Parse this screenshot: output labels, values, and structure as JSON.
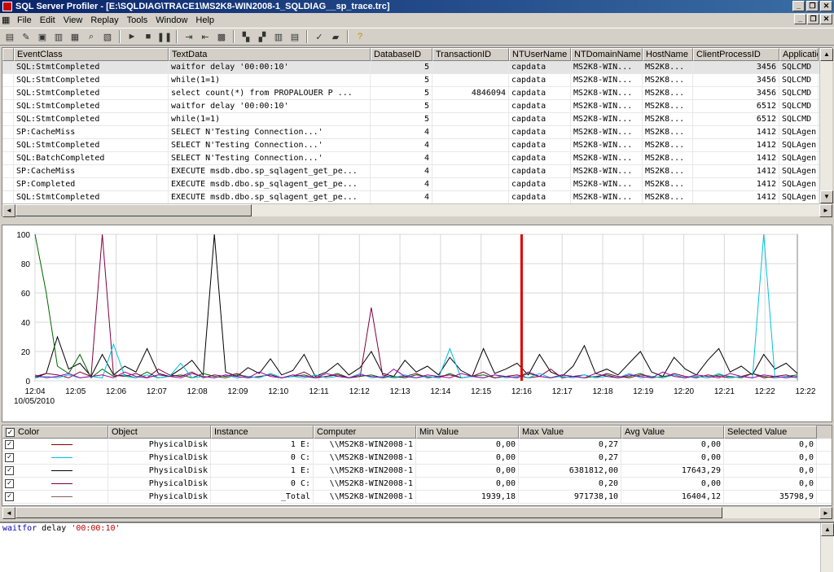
{
  "window": {
    "title": "SQL Server Profiler - [E:\\SQLDIAG\\TRACE1\\MS2K8-WIN2008-1_SQLDIAG__sp_trace.trc]"
  },
  "menu": [
    "File",
    "Edit",
    "View",
    "Replay",
    "Tools",
    "Window",
    "Help"
  ],
  "trace": {
    "columns": [
      "EventClass",
      "TextData",
      "DatabaseID",
      "TransactionID",
      "NTUserName",
      "NTDomainName",
      "HostName",
      "ClientProcessID",
      "Applicatio"
    ],
    "rows": [
      [
        "SQL:StmtCompleted",
        "waitfor delay '00:00:10'",
        "5",
        "",
        "capdata",
        "MS2K8-WIN...",
        "MS2K8...",
        "3456",
        "SQLCMD"
      ],
      [
        "SQL:StmtCompleted",
        "while(1=1)",
        "5",
        "",
        "capdata",
        "MS2K8-WIN...",
        "MS2K8...",
        "3456",
        "SQLCMD"
      ],
      [
        "SQL:StmtCompleted",
        "select count(*) from PROPALOUER P  ...",
        "5",
        "4846094",
        "capdata",
        "MS2K8-WIN...",
        "MS2K8...",
        "3456",
        "SQLCMD"
      ],
      [
        "SQL:StmtCompleted",
        "waitfor delay '00:00:10'",
        "5",
        "",
        "capdata",
        "MS2K8-WIN...",
        "MS2K8...",
        "6512",
        "SQLCMD"
      ],
      [
        "SQL:StmtCompleted",
        "while(1=1)",
        "5",
        "",
        "capdata",
        "MS2K8-WIN...",
        "MS2K8...",
        "6512",
        "SQLCMD"
      ],
      [
        "SP:CacheMiss",
        "SELECT N'Testing Connection...'",
        "4",
        "",
        "capdata",
        "MS2K8-WIN...",
        "MS2K8...",
        "1412",
        "SQLAgen"
      ],
      [
        "SQL:StmtCompleted",
        "SELECT N'Testing Connection...'",
        "4",
        "",
        "capdata",
        "MS2K8-WIN...",
        "MS2K8...",
        "1412",
        "SQLAgen"
      ],
      [
        "SQL:BatchCompleted",
        "SELECT N'Testing Connection...'",
        "4",
        "",
        "capdata",
        "MS2K8-WIN...",
        "MS2K8...",
        "1412",
        "SQLAgen"
      ],
      [
        "SP:CacheMiss",
        "EXECUTE msdb.dbo.sp_sqlagent_get_pe...",
        "4",
        "",
        "capdata",
        "MS2K8-WIN...",
        "MS2K8...",
        "1412",
        "SQLAgen"
      ],
      [
        "SP:Completed",
        "EXECUTE msdb.dbo.sp_sqlagent_get_pe...",
        "4",
        "",
        "capdata",
        "MS2K8-WIN...",
        "MS2K8...",
        "1412",
        "SQLAgen"
      ],
      [
        "SQL:StmtCompleted",
        "EXECUTE msdb.dbo.sp_sqlagent_get_pe...",
        "4",
        "",
        "capdata",
        "MS2K8-WIN...",
        "MS2K8...",
        "1412",
        "SQLAgen"
      ]
    ]
  },
  "chart_data": {
    "type": "line",
    "yticks": [
      "0",
      "20",
      "40",
      "60",
      "80",
      "100"
    ],
    "ylim": [
      0,
      100
    ],
    "xticks": [
      "12:04",
      "12:05",
      "12:06",
      "12:07",
      "12:08",
      "12:09",
      "12:10",
      "12:11",
      "12:12",
      "12:13",
      "12:14",
      "12:15",
      "12:16",
      "12:17",
      "12:18",
      "12:19",
      "12:20",
      "12:21",
      "12:22",
      "12:22"
    ],
    "date_label": "10/05/2010",
    "marker_time": "12:16",
    "series": [
      {
        "color": "#000000",
        "values": [
          2,
          5,
          30,
          8,
          12,
          3,
          18,
          4,
          10,
          6,
          22,
          5,
          3,
          8,
          14,
          4,
          100,
          6,
          3,
          9,
          5,
          15,
          4,
          7,
          18,
          3,
          6,
          12,
          4,
          9,
          20,
          5,
          3,
          14,
          6,
          10,
          4,
          16,
          7,
          3,
          22,
          5,
          8,
          12,
          4,
          18,
          6,
          3,
          10,
          24,
          5,
          8,
          4,
          12,
          20,
          6,
          3,
          16,
          8,
          4,
          14,
          22,
          6,
          10,
          4,
          18,
          8,
          12,
          5
        ]
      },
      {
        "color": "#006400",
        "values": [
          100,
          60,
          10,
          5,
          18,
          2,
          8,
          3,
          4,
          2,
          6,
          2,
          3,
          4,
          2,
          5,
          3,
          2,
          4,
          3,
          2,
          5,
          2,
          3,
          4,
          2,
          3,
          5,
          2,
          3,
          4,
          2,
          3,
          2,
          4,
          3,
          2,
          5,
          2,
          3,
          4,
          2,
          3,
          2,
          5,
          3,
          2,
          4,
          3,
          2,
          3,
          4,
          2,
          3,
          5,
          2,
          3,
          4,
          2,
          3,
          2,
          4,
          3,
          2,
          5,
          3,
          2,
          3,
          4
        ]
      },
      {
        "color": "#800040",
        "values": [
          3,
          5,
          4,
          2,
          6,
          3,
          100,
          4,
          3,
          5,
          2,
          8,
          4,
          3,
          6,
          2,
          4,
          3,
          5,
          2,
          3,
          4,
          2,
          3,
          6,
          2,
          3,
          4,
          2,
          3,
          50,
          4,
          2,
          3,
          5,
          2,
          3,
          4,
          2,
          3,
          6,
          2,
          3,
          4,
          2,
          3,
          8,
          2,
          3,
          4,
          2,
          5,
          3,
          2,
          4,
          3,
          2,
          5,
          3,
          2,
          4,
          3,
          2,
          3,
          5,
          2,
          3,
          4,
          2
        ]
      },
      {
        "color": "#00c0e0",
        "values": [
          2,
          3,
          2,
          4,
          2,
          3,
          2,
          25,
          3,
          2,
          4,
          2,
          3,
          12,
          2,
          3,
          2,
          4,
          2,
          3,
          2,
          5,
          2,
          3,
          2,
          4,
          2,
          3,
          2,
          5,
          2,
          3,
          2,
          4,
          2,
          3,
          2,
          22,
          2,
          3,
          2,
          4,
          2,
          3,
          2,
          5,
          2,
          3,
          2,
          4,
          2,
          3,
          2,
          5,
          2,
          3,
          2,
          4,
          2,
          3,
          2,
          5,
          2,
          3,
          2,
          100,
          2,
          3,
          2
        ]
      },
      {
        "color": "#a000a0",
        "values": [
          4,
          2,
          3,
          5,
          2,
          3,
          4,
          2,
          6,
          3,
          2,
          4,
          3,
          2,
          5,
          3,
          2,
          4,
          3,
          2,
          6,
          3,
          2,
          4,
          3,
          2,
          5,
          3,
          2,
          4,
          3,
          2,
          8,
          3,
          2,
          4,
          3,
          2,
          5,
          3,
          2,
          4,
          3,
          2,
          6,
          3,
          2,
          4,
          3,
          2,
          5,
          3,
          2,
          4,
          3,
          2,
          6,
          3,
          2,
          4,
          3,
          2,
          5,
          3,
          2,
          4,
          3,
          2,
          3
        ]
      }
    ]
  },
  "counters": {
    "columns": [
      "Color",
      "Object",
      "Instance",
      "Computer",
      "Min Value",
      "Max Value",
      "Avg Value",
      "Selected Value"
    ],
    "rows": [
      {
        "color": "#800000",
        "object": "PhysicalDisk",
        "instance": "1 E:",
        "computer": "\\\\MS2K8-WIN2008-1",
        "min": "0,00",
        "max": "0,27",
        "avg": "0,00",
        "sel": "0,0"
      },
      {
        "color": "#00c0e0",
        "object": "PhysicalDisk",
        "instance": "0 C:",
        "computer": "\\\\MS2K8-WIN2008-1",
        "min": "0,00",
        "max": "0,27",
        "avg": "0,00",
        "sel": "0,0"
      },
      {
        "color": "#000000",
        "object": "PhysicalDisk",
        "instance": "1 E:",
        "computer": "\\\\MS2K8-WIN2008-1",
        "min": "0,00",
        "max": "6381812,00",
        "avg": "17643,29",
        "sel": "0,0"
      },
      {
        "color": "#800040",
        "object": "PhysicalDisk",
        "instance": "0 C:",
        "computer": "\\\\MS2K8-WIN2008-1",
        "min": "0,00",
        "max": "0,20",
        "avg": "0,00",
        "sel": "0,0"
      },
      {
        "color": "#806060",
        "object": "PhysicalDisk",
        "instance": "_Total",
        "computer": "\\\\MS2K8-WIN2008-1",
        "min": "1939,18",
        "max": "971738,10",
        "avg": "16404,12",
        "sel": "35798,9"
      }
    ]
  },
  "sql": {
    "keyword": "waitfor",
    "mid": " delay ",
    "string": "'00:00:10'"
  }
}
